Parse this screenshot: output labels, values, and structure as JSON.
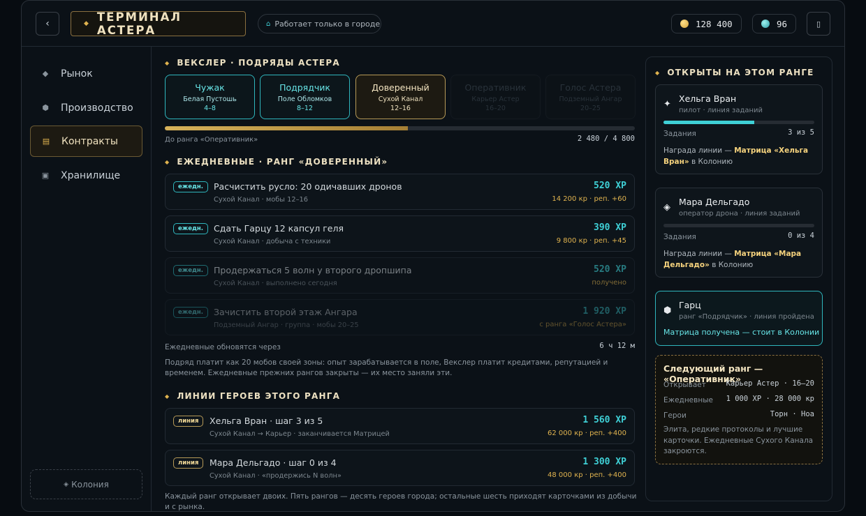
{
  "header": {
    "back_icon": "‹",
    "title": "ТЕРМИНАЛ АСТЕРА",
    "city_pill": "Работает только в городе",
    "credits": "128 400",
    "crystals": "96",
    "menu_icon": "▯",
    "colors": {
      "gold": "#e0b34f",
      "teal": "#3fd0d6"
    }
  },
  "sidebar": {
    "items": [
      {
        "label": "Рынок",
        "icon": "diamond-icon"
      },
      {
        "label": "Производство",
        "icon": "hexagon-icon"
      },
      {
        "label": "Контракты",
        "icon": "list-icon",
        "active": true
      },
      {
        "label": "Хранилище",
        "icon": "box-icon"
      }
    ],
    "colony_label": "Колония"
  },
  "ranks": {
    "section_title": "ВЕКСЛЕР · ПОДРЯДЫ АСТЕРА",
    "cards": [
      {
        "name": "Чужак",
        "zone": "Белая Пустошь",
        "levels": "4–8",
        "state": "done"
      },
      {
        "name": "Подрядчик",
        "zone": "Поле Обломков",
        "levels": "8–12",
        "state": "done"
      },
      {
        "name": "Доверенный",
        "zone": "Сухой Канал",
        "levels": "12–16",
        "state": "current"
      },
      {
        "name": "Оперативник",
        "zone": "Карьер Астер",
        "levels": "16–20",
        "state": "locked"
      },
      {
        "name": "Голос Астера",
        "zone": "Подземный Ангар",
        "levels": "20–25",
        "state": "locked"
      }
    ],
    "progress_fraction": 0.517,
    "progress_label": "До ранга «Оперативник»",
    "progress_value": "2 480 / 4 800"
  },
  "dailies": {
    "section_title": "ЕЖЕДНЕВНЫЕ · РАНГ «ДОВЕРЕННЫЙ»",
    "items": [
      {
        "badge": "ежедн.",
        "title": "Расчистить русло: 20 одичавших дронов",
        "sub": "Сухой Канал · мобы 12–16",
        "xp": "520 XP",
        "reward": "14 200 кр · реп. +60",
        "state": "active"
      },
      {
        "badge": "ежедн.",
        "title": "Сдать Гарцу 12 капсул геля",
        "sub": "Сухой Канал · добыча с техники",
        "xp": "390 XP",
        "reward": "9 800 кр · реп. +45",
        "state": "active"
      },
      {
        "badge": "ежедн.",
        "title": "Продержаться 5 волн у второго дропшипа",
        "sub": "Сухой Канал · выполнено сегодня",
        "xp": "520 XP",
        "reward": "получено",
        "state": "done"
      },
      {
        "badge": "ежедн.",
        "title": "Зачистить второй этаж Ангара",
        "sub": "Подземный Ангар · группа · мобы 20–25",
        "xp": "1 920 XP",
        "reward": "с ранга «Голос Астера»",
        "state": "locked"
      }
    ],
    "refresh_label": "Ежедневные обновятся через",
    "refresh_value": "6 ч 12 м",
    "note": "Подряд платит как 20 мобов своей зоны: опыт зарабатывается в поле, Векслер платит кредитами, репутацией и временем. Ежедневные прежних рангов закрыты — их место заняли эти."
  },
  "hero_lines": {
    "section_title": "ЛИНИИ ГЕРОЕВ ЭТОГО РАНГА",
    "items": [
      {
        "badge": "линия",
        "title": "Хельга Вран · шаг 3 из 5",
        "sub": "Сухой Канал → Карьер · заканчивается Матрицей",
        "xp": "1 560 XP",
        "reward": "62 000 кр · реп. +400"
      },
      {
        "badge": "линия",
        "title": "Мара Дельгадо · шаг 0 из 4",
        "sub": "Сухой Канал · «продержись N волн»",
        "xp": "1 300 XP",
        "reward": "48 000 кр · реп. +400"
      }
    ],
    "footer": "Каждый ранг открывает двоих. Пять рангов — десять героев города; остальные шесть приходят карточками из добычи и с рынка."
  },
  "right_panel": {
    "title": "ОТКРЫТЫ НА ЭТОМ РАНГЕ",
    "heroes": [
      {
        "icon": "✦",
        "name": "Хельга Вран",
        "role": "пилот · линия заданий",
        "tasks_label": "Задания",
        "tasks_value": "3 из 5",
        "progress_fraction": 0.6,
        "reward_prefix": "Награда линии — ",
        "reward_item": "Матрица «Хельга Вран»",
        "reward_suffix": " в Колонию"
      },
      {
        "icon": "◈",
        "name": "Мара Дельгадо",
        "role": "оператор дрона · линия заданий",
        "tasks_label": "Задания",
        "tasks_value": "0 из 4",
        "progress_fraction": 0,
        "reward_prefix": "Награда линии — ",
        "reward_item": "Матрица «Мара Дельгадо»",
        "reward_suffix": " в Колонию"
      },
      {
        "icon": "⬢",
        "name": "Гарц",
        "role": "ранг «Подрядчик» · линия пройдена",
        "status": "Матрица получена — стоит в Колонии"
      }
    ],
    "next_rank": {
      "title": "Следующий ранг — «Оперативник»",
      "rows": [
        {
          "label": "Открывает",
          "value": "Карьер Астер · 16–20"
        },
        {
          "label": "Ежедневные",
          "value": "1 000 XP · 28 000 кр"
        },
        {
          "label": "Герои",
          "value": "Торн · Ноа"
        }
      ],
      "description": "Элита, редкие протоколы и лучшие карточки. Ежедневные Сухого Канала закроются."
    }
  }
}
